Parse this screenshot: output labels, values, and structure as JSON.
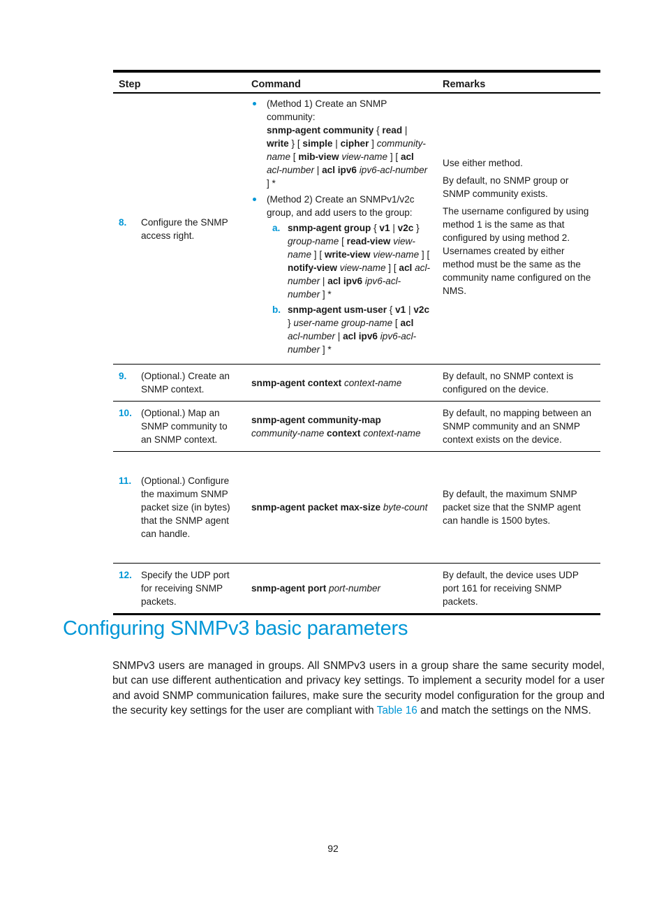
{
  "table": {
    "headers": {
      "step": "Step",
      "command": "Command",
      "remarks": "Remarks"
    },
    "rows": [
      {
        "number": "8.",
        "step": "Configure the SNMP access right.",
        "command": {
          "method1_intro": "(Method 1) Create an SNMP community:",
          "method1_cmd": [
            {
              "t": "snmp-agent community",
              "s": "b"
            },
            {
              "t": " { ",
              "s": ""
            },
            {
              "t": "read",
              "s": "b"
            },
            {
              "t": " | ",
              "s": ""
            },
            {
              "t": "write",
              "s": "b"
            },
            {
              "t": " } [ ",
              "s": ""
            },
            {
              "t": "simple",
              "s": "b"
            },
            {
              "t": " | ",
              "s": ""
            },
            {
              "t": "cipher",
              "s": "b"
            },
            {
              "t": " ] ",
              "s": ""
            },
            {
              "t": "community-name",
              "s": "i"
            },
            {
              "t": " [ ",
              "s": ""
            },
            {
              "t": "mib-view",
              "s": "b"
            },
            {
              "t": " ",
              "s": ""
            },
            {
              "t": "view-name",
              "s": "i"
            },
            {
              "t": " ] [ ",
              "s": ""
            },
            {
              "t": "acl",
              "s": "b"
            },
            {
              "t": " ",
              "s": ""
            },
            {
              "t": "acl-number",
              "s": "i"
            },
            {
              "t": " | ",
              "s": ""
            },
            {
              "t": "acl ipv6",
              "s": "b"
            },
            {
              "t": " ",
              "s": ""
            },
            {
              "t": "ipv6-acl-number",
              "s": "i"
            },
            {
              "t": " ] *",
              "s": ""
            }
          ],
          "method2_intro": "(Method 2) Create an SNMPv1/v2c group, and add users to the group:",
          "sub_steps": [
            {
              "letter": "a.",
              "cmd": [
                {
                  "t": "snmp-agent group",
                  "s": "b"
                },
                {
                  "t": " { ",
                  "s": ""
                },
                {
                  "t": "v1",
                  "s": "b"
                },
                {
                  "t": " | ",
                  "s": ""
                },
                {
                  "t": "v2c",
                  "s": "b"
                },
                {
                  "t": " } ",
                  "s": ""
                },
                {
                  "t": "group-name",
                  "s": "i"
                },
                {
                  "t": " [ ",
                  "s": ""
                },
                {
                  "t": "read-view",
                  "s": "b"
                },
                {
                  "t": " ",
                  "s": ""
                },
                {
                  "t": "view-name",
                  "s": "i"
                },
                {
                  "t": " ] [ ",
                  "s": ""
                },
                {
                  "t": "write-view",
                  "s": "b"
                },
                {
                  "t": " ",
                  "s": ""
                },
                {
                  "t": "view-name",
                  "s": "i"
                },
                {
                  "t": " ] [ ",
                  "s": ""
                },
                {
                  "t": "notify-view",
                  "s": "b"
                },
                {
                  "t": " ",
                  "s": ""
                },
                {
                  "t": "view-name",
                  "s": "i"
                },
                {
                  "t": " ] [ ",
                  "s": ""
                },
                {
                  "t": "acl",
                  "s": "b"
                },
                {
                  "t": " ",
                  "s": ""
                },
                {
                  "t": "acl-number",
                  "s": "i"
                },
                {
                  "t": " | ",
                  "s": ""
                },
                {
                  "t": "acl ipv6",
                  "s": "b"
                },
                {
                  "t": " ",
                  "s": ""
                },
                {
                  "t": "ipv6-acl-number",
                  "s": "i"
                },
                {
                  "t": " ] *",
                  "s": ""
                }
              ]
            },
            {
              "letter": "b.",
              "cmd": [
                {
                  "t": "snmp-agent usm-user",
                  "s": "b"
                },
                {
                  "t": " { ",
                  "s": ""
                },
                {
                  "t": "v1",
                  "s": "b"
                },
                {
                  "t": " | ",
                  "s": ""
                },
                {
                  "t": "v2c",
                  "s": "b"
                },
                {
                  "t": " } ",
                  "s": ""
                },
                {
                  "t": "user-name group-name",
                  "s": "i"
                },
                {
                  "t": " [ ",
                  "s": ""
                },
                {
                  "t": "acl",
                  "s": "b"
                },
                {
                  "t": " ",
                  "s": ""
                },
                {
                  "t": "acl-number",
                  "s": "i"
                },
                {
                  "t": " | ",
                  "s": ""
                },
                {
                  "t": "acl ipv6",
                  "s": "b"
                },
                {
                  "t": " ",
                  "s": ""
                },
                {
                  "t": "ipv6-acl-number",
                  "s": "i"
                },
                {
                  "t": " ] *",
                  "s": ""
                }
              ]
            }
          ]
        },
        "remarks": [
          "Use either method.",
          "By default, no SNMP group or SNMP community exists.",
          "The username configured by using method 1 is the same as that configured by using method 2. Usernames created by either method must be the same as the community name configured on the NMS."
        ]
      },
      {
        "number": "9.",
        "step": "(Optional.) Create an SNMP context.",
        "command": [
          {
            "t": "snmp-agent context",
            "s": "b"
          },
          {
            "t": " ",
            "s": ""
          },
          {
            "t": "context-name",
            "s": "i"
          }
        ],
        "remarks": [
          "By default, no SNMP context is configured on the device."
        ]
      },
      {
        "number": "10.",
        "step": "(Optional.) Map an SNMP community to an SNMP context.",
        "command": [
          {
            "t": "snmp-agent community-map",
            "s": "b"
          },
          {
            "t": " ",
            "s": ""
          },
          {
            "t": "community-name",
            "s": "i"
          },
          {
            "t": " ",
            "s": ""
          },
          {
            "t": "context",
            "s": "b"
          },
          {
            "t": " ",
            "s": ""
          },
          {
            "t": "context-name",
            "s": "i"
          }
        ],
        "remarks": [
          "By default, no mapping between an SNMP community and an SNMP context exists on the device."
        ]
      },
      {
        "number": "11.",
        "step": "(Optional.) Configure the maximum SNMP packet size (in bytes) that the SNMP agent can handle.",
        "command": [
          {
            "t": "snmp-agent packet max-size",
            "s": "b"
          },
          {
            "t": " ",
            "s": ""
          },
          {
            "t": "byte-count",
            "s": "i"
          }
        ],
        "remarks": [
          "By default, the maximum SNMP packet size that the SNMP agent can handle is 1500 bytes."
        ]
      },
      {
        "number": "12.",
        "step": "Specify the UDP port for receiving SNMP packets.",
        "command": [
          {
            "t": "snmp-agent port",
            "s": "b"
          },
          {
            "t": " ",
            "s": ""
          },
          {
            "t": "port-number",
            "s": "i"
          }
        ],
        "remarks": [
          "By default, the device uses UDP port 161 for receiving SNMP packets."
        ]
      }
    ]
  },
  "section": {
    "title": "Configuring SNMPv3 basic parameters",
    "body_before_link": "SNMPv3 users are managed in groups. All SNMPv3 users in a group share the same security model, but can use different authentication and privacy key settings. To implement a security model for a user and avoid SNMP communication failures, make sure the security model configuration for the group and the security key settings for the user are compliant with ",
    "link_text": "Table 16",
    "body_after_link": " and match the settings on the NMS."
  },
  "page_number": "92",
  "colors": {
    "accent": "#0096d6",
    "text": "#1a1a1a",
    "rule": "#000000"
  }
}
